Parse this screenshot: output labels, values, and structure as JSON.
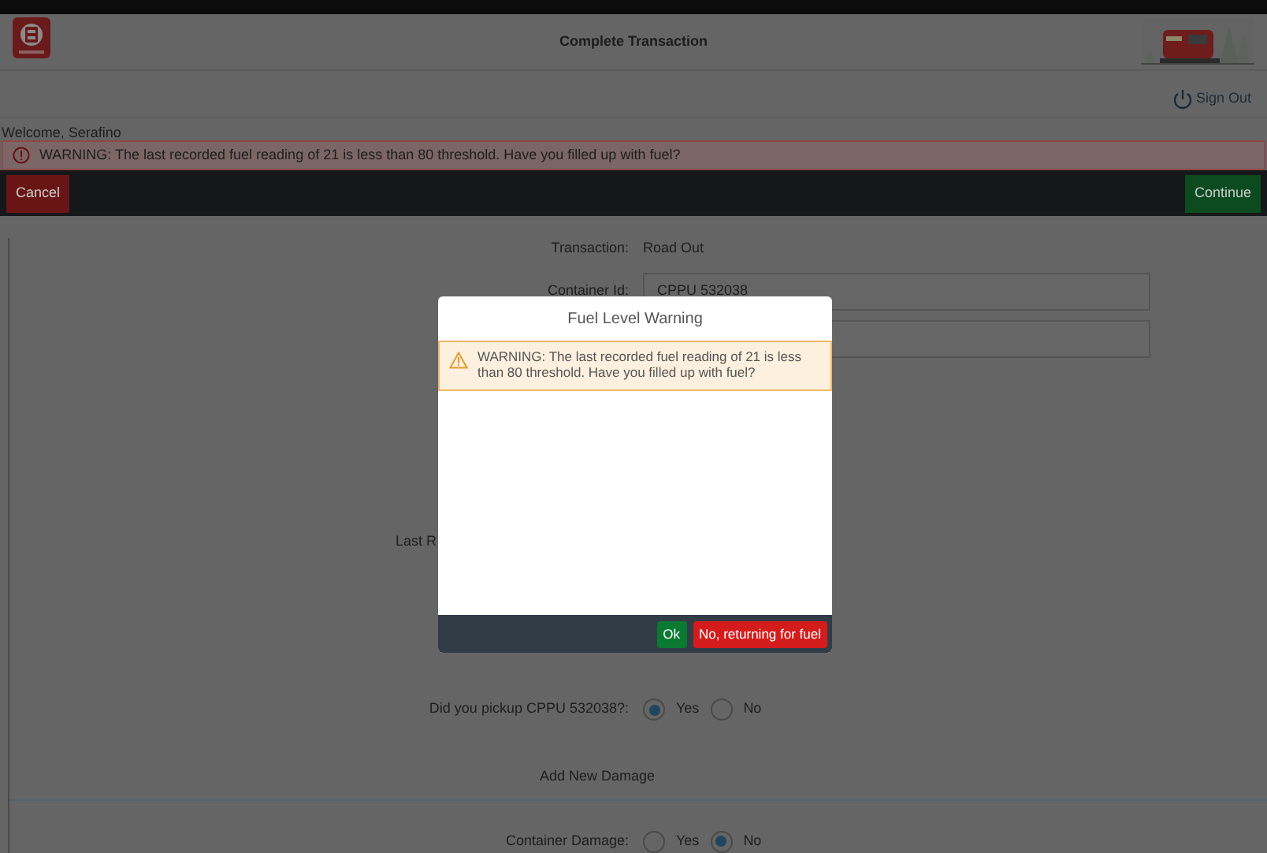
{
  "header": {
    "title": "Complete Transaction"
  },
  "sign_out": "Sign Out",
  "welcome": "Welcome, Serafino",
  "alert": "WARNING: The last recorded fuel reading of 21 is less than 80 threshold. Have you filled up with fuel?",
  "toolbar": [
    {
      "label": "Cancel",
      "kind": "danger"
    },
    {
      "label": "Continue",
      "kind": "success"
    }
  ],
  "form": [
    {
      "kind": "text",
      "label": "Transaction:",
      "value": "Road Out"
    },
    {
      "kind": "input",
      "label": "Container Id:",
      "value": "CPPU 532038"
    },
    {
      "kind": "input"
    },
    {
      "kind": "text",
      "label": "Last R"
    },
    {
      "kind": "radio",
      "label": "Did you pickup CPPU 532038?:",
      "options": [
        {
          "label": "Yes",
          "selected": true
        },
        {
          "label": "No",
          "selected": false
        }
      ]
    },
    {
      "kind": "heading",
      "label": "Add New Damage"
    },
    {
      "kind": "radio",
      "label": "Container Damage:",
      "options": [
        {
          "label": "Yes",
          "selected": false
        },
        {
          "label": "No",
          "selected": true
        }
      ]
    }
  ],
  "modal": {
    "title": "Fuel Level Warning",
    "warning": "WARNING: The last recorded fuel reading of 21 is less than 80 threshold. Have you filled up with fuel?",
    "buttons": [
      {
        "label": "Ok",
        "kind": "success"
      },
      {
        "label": "No, returning for fuel",
        "kind": "danger"
      }
    ]
  }
}
